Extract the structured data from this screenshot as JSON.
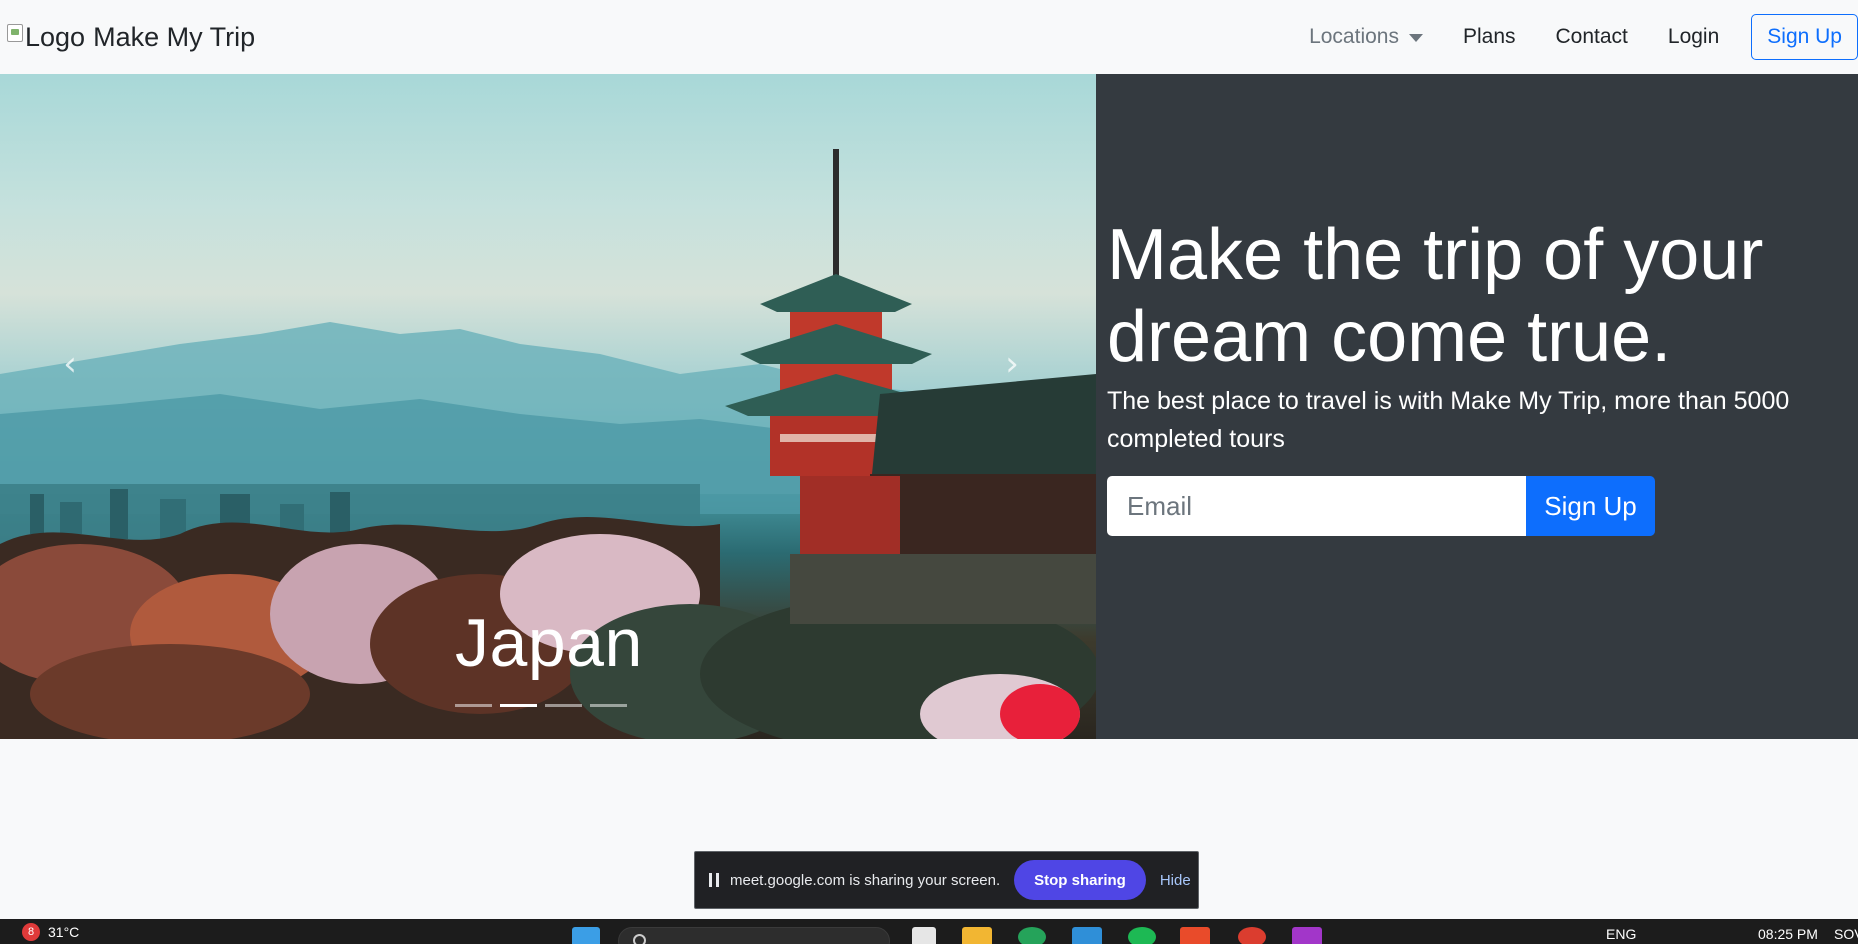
{
  "navbar": {
    "brand_alt": "Logo",
    "brand_name": "Make My Trip",
    "links": {
      "locations": "Locations",
      "plans": "Plans",
      "contact": "Contact",
      "login": "Login"
    },
    "signup_label": "Sign Up"
  },
  "carousel": {
    "caption": "Japan",
    "prev_icon": "chevron-left-icon",
    "next_icon": "chevron-right-icon",
    "active_index": 1,
    "slide_count": 4
  },
  "hero": {
    "headline": "Make the trip of your dream come true.",
    "subtext": "The best place to travel is with Make My Trip, more than 5000 completed tours",
    "email_placeholder": "Email",
    "signup_button": "Sign Up"
  },
  "share_bar": {
    "message": "meet.google.com is sharing your screen.",
    "stop_label": "Stop sharing",
    "hide_label": "Hide"
  },
  "taskbar": {
    "weather_badge": "8",
    "temperature": "31°C",
    "language": "ENG",
    "time": "08:25 PM",
    "tray_text": "SOV"
  },
  "colors": {
    "primary": "#0d6efd",
    "hero_bg": "#343a40",
    "stop_sharing": "#4f46e5",
    "navbar_bg": "#f8f9fa"
  }
}
